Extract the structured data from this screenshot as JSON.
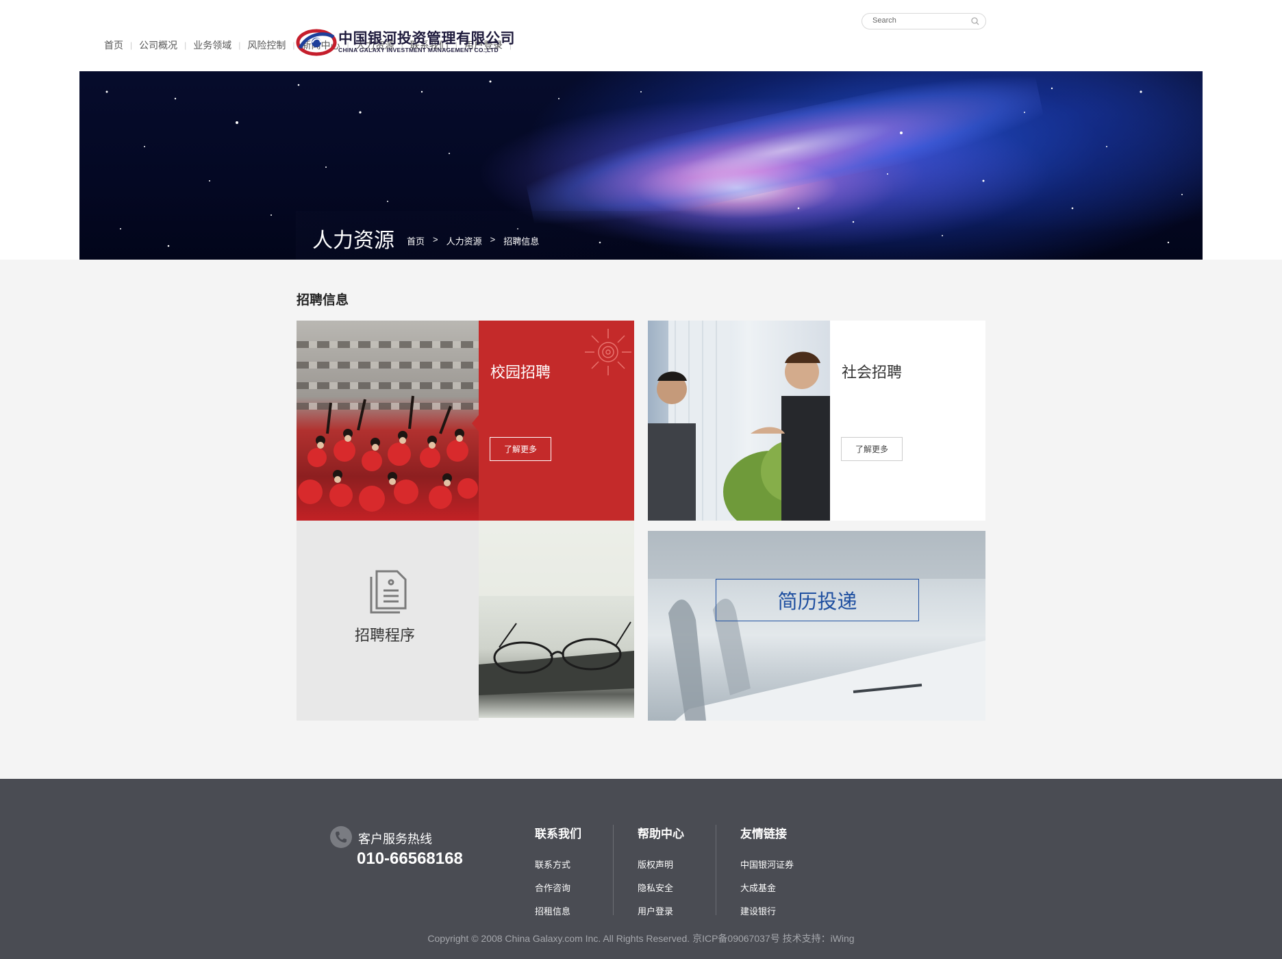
{
  "nav": {
    "items": [
      "首页",
      "公司概况",
      "业务领域",
      "风险控制",
      "新闻中心",
      "人力资源",
      "联系我们",
      "用户登录"
    ]
  },
  "logo": {
    "cn": "中国银河投资管理有限公司",
    "en": "CHINA GALAXY INVESTMENT MANAGEMENT CO.,LTD"
  },
  "search": {
    "placeholder": "Search"
  },
  "banner": {
    "title": "人力资源",
    "breadcrumb": [
      "首页",
      ">",
      "人力资源",
      ">",
      "招聘信息"
    ]
  },
  "section": {
    "title": "招聘信息"
  },
  "tiles": {
    "campus": {
      "title": "校园招聘",
      "button": "了解更多"
    },
    "social": {
      "title": "社会招聘",
      "button": "了解更多"
    },
    "process": {
      "title": "招聘程序"
    },
    "resume": {
      "title": "简历投递"
    }
  },
  "footer": {
    "hotline_label": "客户服务热线",
    "hotline_number": "010-66568168",
    "columns": [
      {
        "title": "联系我们",
        "links": [
          "联系方式",
          "合作咨询",
          "招租信息"
        ]
      },
      {
        "title": "帮助中心",
        "links": [
          "版权声明",
          "隐私安全",
          "用户登录"
        ]
      },
      {
        "title": "友情链接",
        "links": [
          "中国银河证券",
          "大成基金",
          "建设银行"
        ]
      }
    ],
    "copyright": "Copyright © 2008 China Galaxy.com Inc. All Rights Reserved. 京ICP备09067037号 技术支持：iWing"
  },
  "colors": {
    "accent_red": "#c42a2a",
    "resume_blue": "#1f4fa0",
    "footer_bg": "#4a4c53"
  }
}
